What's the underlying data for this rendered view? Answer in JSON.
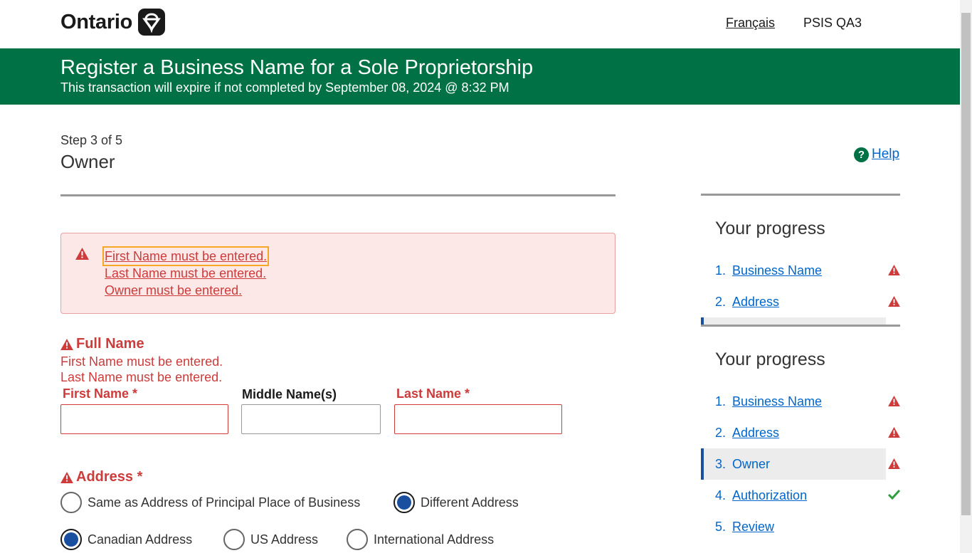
{
  "header": {
    "logo_text": "Ontario",
    "language_link": "Français",
    "environment": "PSIS QA3"
  },
  "banner": {
    "title": "Register a Business Name for a Sole Proprietorship",
    "subtitle": "This transaction will expire if not completed by September 08, 2024 @ 8:32 PM",
    "color": "#007144"
  },
  "page": {
    "step": "Step 3 of 5",
    "title": "Owner",
    "help_label": "Help"
  },
  "error_summary": {
    "items": [
      "First Name must be entered.",
      "Last Name must be entered.",
      "Owner must be entered."
    ]
  },
  "full_name": {
    "legend": "Full Name",
    "errors": [
      "First Name must be entered.",
      "Last Name must be entered."
    ],
    "first_name_label": "First Name *",
    "middle_name_label": "Middle Name(s)",
    "last_name_label": "Last Name *",
    "first_name_value": "",
    "middle_name_value": "",
    "last_name_value": ""
  },
  "address": {
    "legend": "Address *",
    "source_options": [
      {
        "label": "Same as Address of Principal Place of Business",
        "checked": false
      },
      {
        "label": "Different Address",
        "checked": true
      }
    ],
    "type_options": [
      {
        "label": "Canadian Address",
        "checked": true
      },
      {
        "label": "US Address",
        "checked": false
      },
      {
        "label": "International Address",
        "checked": false
      }
    ]
  },
  "progress_sticky": {
    "title": "Your progress",
    "items": [
      {
        "num": "1.",
        "label": "Business Name",
        "status": "error"
      },
      {
        "num": "2.",
        "label": "Address",
        "status": "error"
      }
    ]
  },
  "progress": {
    "title": "Your progress",
    "items": [
      {
        "num": "1.",
        "label": "Business Name",
        "status": "error"
      },
      {
        "num": "2.",
        "label": "Address",
        "status": "error"
      },
      {
        "num": "3.",
        "label": "Owner",
        "status": "error",
        "current": true
      },
      {
        "num": "4.",
        "label": "Authorization",
        "status": "complete"
      },
      {
        "num": "5.",
        "label": "Review",
        "status": "none"
      }
    ]
  },
  "colors": {
    "error": "#cd3b3b",
    "link": "#0066cc",
    "success": "#2e9e3e",
    "focus": "#f5a623"
  }
}
